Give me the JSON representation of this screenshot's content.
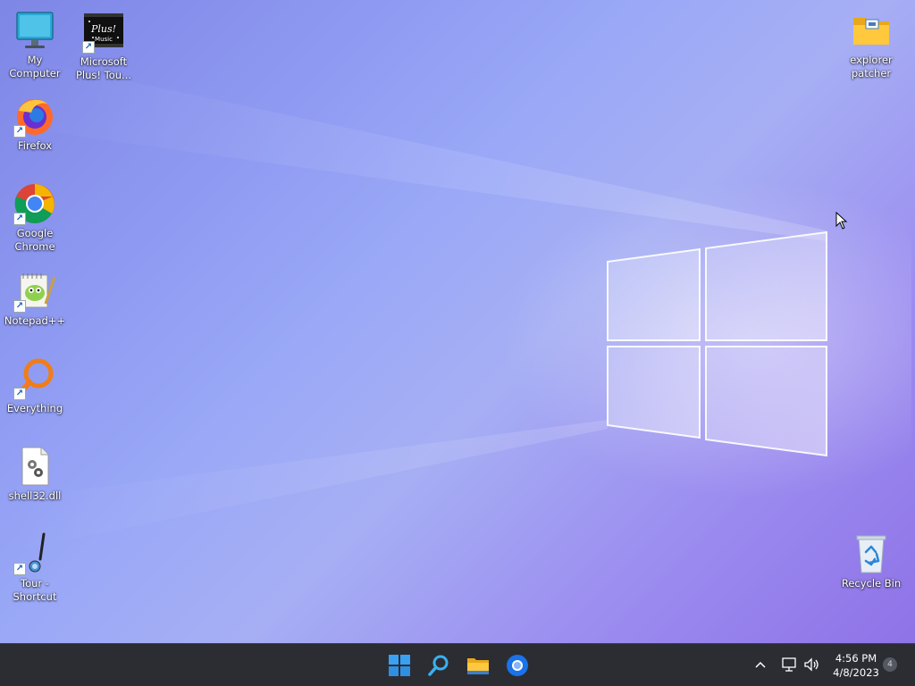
{
  "desktop_icons_left": [
    {
      "id": "my-computer",
      "label": "My Computer",
      "icon": "monitor-icon",
      "shortcut": false
    },
    {
      "id": "microsoft-plus",
      "label": "Microsoft Plus! Tou...",
      "icon": "plus-music-icon",
      "shortcut": true,
      "icon_text": "Plus! Music"
    },
    {
      "id": "firefox",
      "label": "Firefox",
      "icon": "firefox-icon",
      "shortcut": true
    },
    {
      "id": "google-chrome",
      "label": "Google Chrome",
      "icon": "chrome-icon",
      "shortcut": true
    },
    {
      "id": "notepadpp",
      "label": "Notepad++",
      "icon": "notepadpp-icon",
      "shortcut": true
    },
    {
      "id": "everything",
      "label": "Everything",
      "icon": "search-magnifier-icon",
      "shortcut": true
    },
    {
      "id": "shell32",
      "label": "shell32.dll",
      "icon": "dll-file-icon",
      "shortcut": false
    },
    {
      "id": "tour",
      "label": "Tour - Shortcut",
      "icon": "tour-icon",
      "shortcut": true
    }
  ],
  "desktop_icons_right": [
    {
      "id": "explorer-patcher",
      "label": "explorer patcher",
      "icon": "folder-icon"
    },
    {
      "id": "recycle-bin",
      "label": "Recycle Bin",
      "icon": "recycle-bin-icon"
    }
  ],
  "taskbar": {
    "pinned": [
      {
        "id": "start",
        "icon": "windows-start-icon"
      },
      {
        "id": "search",
        "icon": "search-icon"
      },
      {
        "id": "file-explorer",
        "icon": "file-explorer-icon"
      },
      {
        "id": "chrome",
        "icon": "chrome-taskbar-icon"
      }
    ],
    "tray": {
      "clock_time": "4:56 PM",
      "clock_date": "4/8/2023",
      "notification_count": "4"
    }
  },
  "colors": {
    "taskbar_bg": "#2b2d33",
    "accent_blue": "#1a73e8",
    "wallpaper_primary": "#8f9bf2"
  }
}
